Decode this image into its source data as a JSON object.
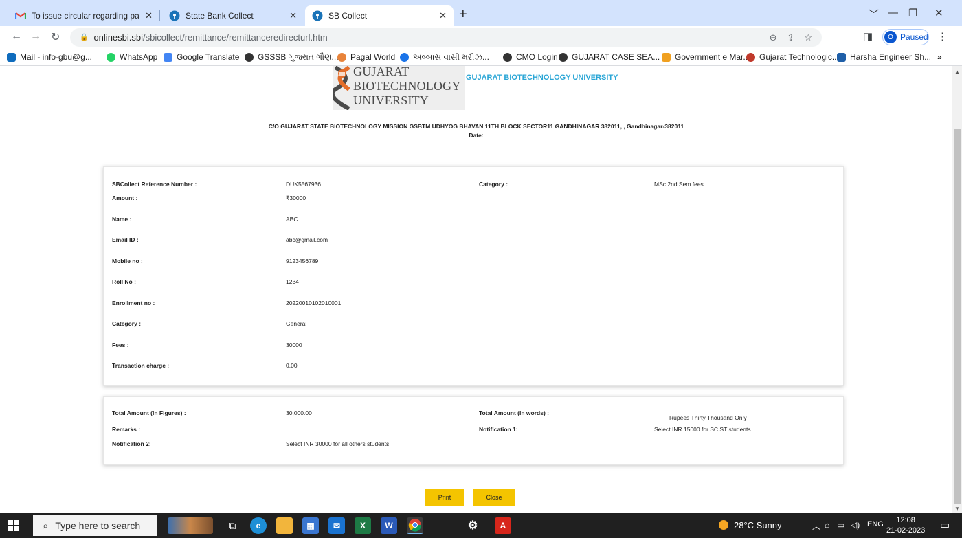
{
  "browser": {
    "tabs": [
      {
        "title": "To issue circular regarding payme",
        "icon": "gmail-icon"
      },
      {
        "title": "State Bank Collect",
        "icon": "sbi-icon"
      },
      {
        "title": "SB Collect",
        "icon": "sbi-icon",
        "active": true
      }
    ],
    "url_domain": "onlinesbi.sbi",
    "url_path": "/sbicollect/remittance/remittanceredirecturl.htm",
    "profile_initial": "O",
    "profile_status": "Paused",
    "bookmarks": [
      "Mail - info-gbu@g...",
      "WhatsApp",
      "Google Translate",
      "GSSSB ગુજરાત ગૌણ...",
      "Pagal World",
      "અબ્બાસ વાસી મરીઝ...",
      "CMO Login",
      "GUJARAT CASE SEA...",
      "Government e Mar...",
      "Gujarat Technologic...",
      "Harsha Engineer Sh..."
    ],
    "bookmarks_more": "»"
  },
  "page": {
    "logo_lines": [
      "GUJARAT",
      "BIOTECHNOLOGY",
      "UNIVERSITY"
    ],
    "university_name": "GUJARAT BIOTECHNOLOGY UNIVERSITY",
    "address": "C/O GUJARAT STATE BIOTECHNOLOGY MISSION GSBTM UDHYOG BHAVAN 11TH BLOCK SECTOR11 GANDHINAGAR 382011, , Gandhinagar-382011",
    "date_label": "Date:",
    "details": {
      "ref_label": "SBCollect Reference Number :",
      "ref_value": "DUK5567936",
      "category_top_label": "Category :",
      "category_top_value": "MSc 2nd Sem fees",
      "amount_label": "Amount :",
      "amount_value": "₹30000",
      "rows": [
        {
          "label": "Name :",
          "value": "ABC"
        },
        {
          "label": "Email ID :",
          "value": "abc@gmail.com"
        },
        {
          "label": "Mobile no :",
          "value": "9123456789"
        },
        {
          "label": "Roll No :",
          "value": "1234"
        },
        {
          "label": "Enrollment no :",
          "value": "20220010102010001"
        },
        {
          "label": "Category :",
          "value": "General"
        },
        {
          "label": "Fees :",
          "value": "30000"
        },
        {
          "label": "Transaction charge :",
          "value": "0.00"
        }
      ]
    },
    "summary": {
      "total_figures_label": "Total Amount (In Figures) :",
      "total_figures_value": "30,000.00",
      "total_words_label": "Total Amount (In words) :",
      "total_words_value": "Rupees Thirty Thousand Only",
      "remarks_label": "Remarks :",
      "notification1_label": "Notification 1:",
      "notification1_value": "Select INR 15000 for SC,ST students.",
      "notification2_label": "Notification 2:",
      "notification2_value": "Select INR 30000 for all others students."
    },
    "print_label": "Print",
    "close_label": "Close"
  },
  "taskbar": {
    "search_placeholder": "Type here to search",
    "weather": "28°C  Sunny",
    "language": "ENG",
    "time": "12:08",
    "date": "21-02-2023"
  },
  "colors": {
    "accent_button": "#f4c400",
    "university_blue": "#2aa6d6",
    "logo_orange": "#e46e2b"
  }
}
